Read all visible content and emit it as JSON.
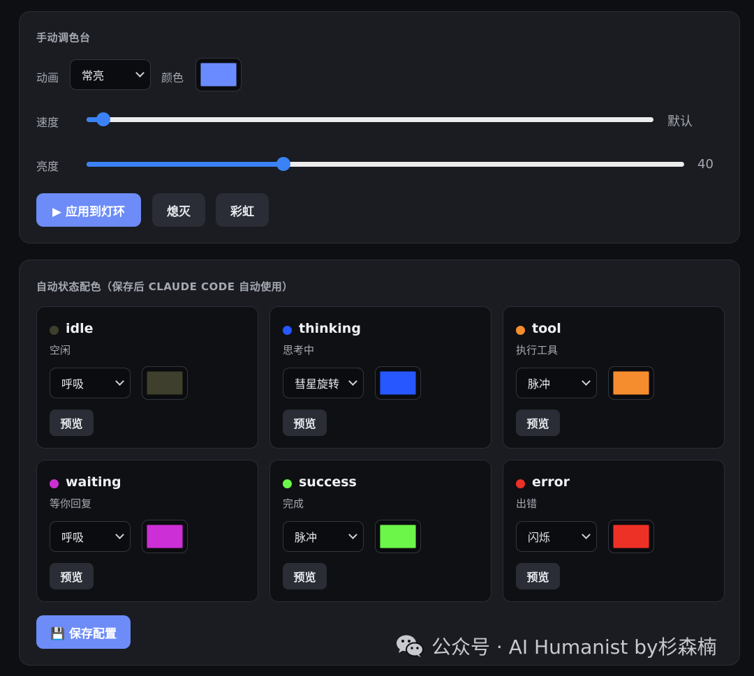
{
  "manual": {
    "title": "手动调色台",
    "animation_label": "动画",
    "animation_value": "常亮",
    "color_label": "颜色",
    "color_value": "#6a8bff",
    "speed_label": "速度",
    "speed_value_text": "默认",
    "speed_level": 0.03,
    "brightness_label": "亮度",
    "brightness_value": "40",
    "brightness_level": 0.33,
    "apply_button": "▶ 应用到灯环",
    "off_button": "熄灭",
    "rainbow_button": "彩虹"
  },
  "auto": {
    "title": "自动状态配色（保存后 CLAUDE CODE 自动使用）",
    "preview_label": "预览",
    "states": [
      {
        "name": "idle",
        "desc": "空闲",
        "animation": "呼吸",
        "color": "#3e3f2c",
        "dot": "#3e3f2c"
      },
      {
        "name": "thinking",
        "desc": "思考中",
        "animation": "彗星旋转",
        "color": "#2757ff",
        "dot": "#2757ff"
      },
      {
        "name": "tool",
        "desc": "执行工具",
        "animation": "脉冲",
        "color": "#f58d2f",
        "dot": "#f58d2f"
      },
      {
        "name": "waiting",
        "desc": "等你回复",
        "animation": "呼吸",
        "color": "#cc2fd6",
        "dot": "#cc2fd6"
      },
      {
        "name": "success",
        "desc": "完成",
        "animation": "脉冲",
        "color": "#6df64a",
        "dot": "#6df64a"
      },
      {
        "name": "error",
        "desc": "出错",
        "animation": "闪烁",
        "color": "#ee3127",
        "dot": "#ee3127"
      }
    ],
    "save_button": "💾 保存配置"
  },
  "watermark": {
    "text": "公众号 · AI Humanist by杉森楠",
    "icon": "wechat-icon"
  }
}
